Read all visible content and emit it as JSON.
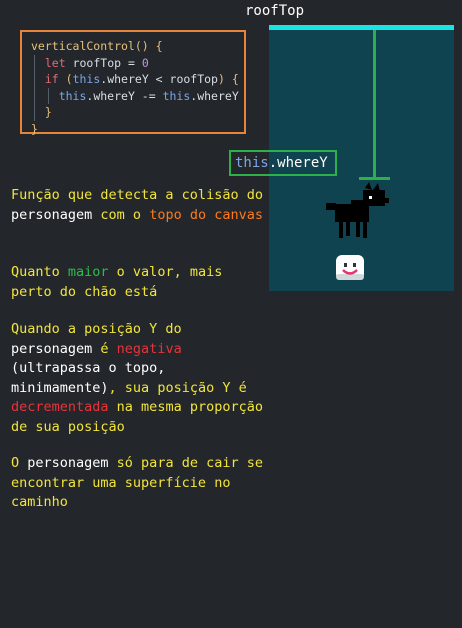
{
  "roof_label": "roofTop",
  "code": {
    "line1": {
      "fn": "verticalControl",
      "rest": "() {"
    },
    "line2": {
      "kw": "let",
      "var": "roofTop",
      "op": " = ",
      "num": "0"
    },
    "line3": {
      "kw": "if",
      "open": " (",
      "this": "this",
      "prop": ".whereY < roofTop",
      "close": ") {"
    },
    "line4": {
      "this1": "this",
      "prop1": ".whereY -= ",
      "this2": "this",
      "prop2": ".whereY"
    },
    "line5": "}",
    "line6": "}"
  },
  "label": {
    "this": "this",
    "prop": ".whereY"
  },
  "para1": {
    "t1": "Função que detecta a colisão do ",
    "t2": "personagem",
    "t3": " com o ",
    "t4": "topo do canvas"
  },
  "para2": {
    "t1": "Quanto ",
    "t2": "maior",
    "t3": " o valor, mais perto do chão está"
  },
  "para3": {
    "t1": "Quando a posição Y do ",
    "t2": "personagem",
    "t3": " é ",
    "t4": "negativa",
    "t5": " (ultrapassa o topo, minimamente)",
    "t6": ", sua posição Y é ",
    "t7": "decrementada",
    "t8": " na mesma proporção de sua posição"
  },
  "para4": {
    "t1": "O ",
    "t2": "personagem",
    "t3": " só para de cair se encontrar uma superfície no caminho"
  },
  "colors": {
    "background": "#23272b",
    "canvas": "#0e434f",
    "roof": "#19e3e3",
    "measure": "#2bb04a",
    "code_border": "#e8833a",
    "text_yellow": "#f2e53a"
  }
}
